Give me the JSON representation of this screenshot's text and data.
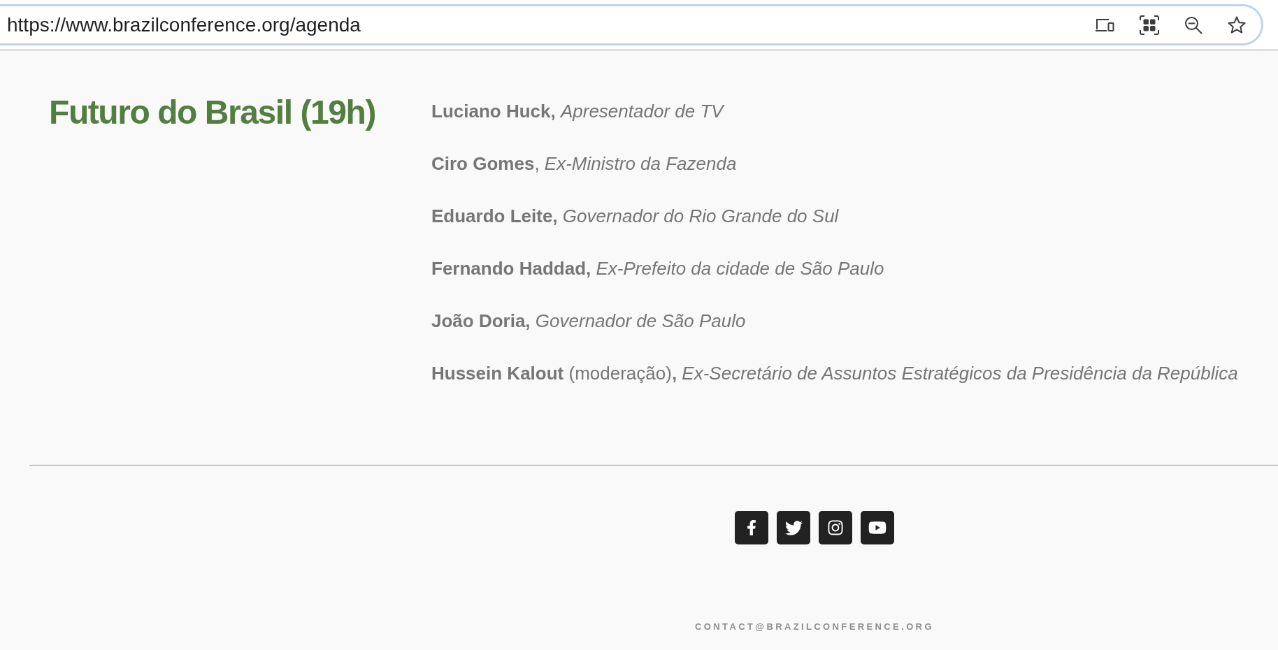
{
  "address_bar": {
    "url": "https://www.brazilconference.org/agenda"
  },
  "session": {
    "title": "Futuro do Brasil (19h)",
    "speakers": [
      "**Luciano Huck,** *Apresentador de TV*",
      "**Ciro Gomes**, *Ex-Ministro da Fazenda*",
      "**Eduardo Leite,** *Governador do Rio Grande do Sul*",
      "**Fernando Haddad,** *Ex-Prefeito da cidade de São Paulo*",
      "**João Doria,** *Governador de São Paulo*",
      "**Hussein Kalout** (moderação)**,** *Ex-Secretário de Assuntos Estratégicos da Presidência da República*"
    ]
  },
  "footer": {
    "email": "CONTACT@BRAZILCONFERENCE.ORG"
  }
}
